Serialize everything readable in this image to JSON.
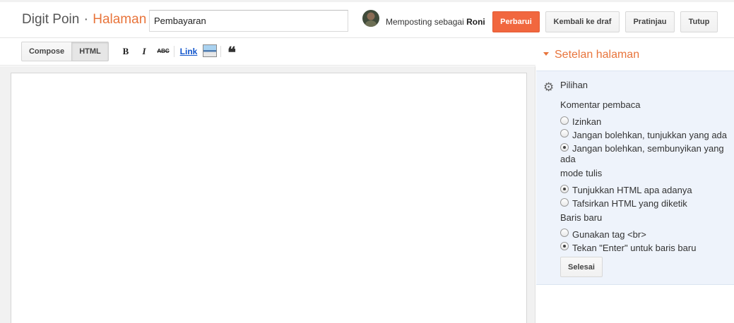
{
  "header": {
    "blog_name": "Digit Poin",
    "separator": "·",
    "section": "Halaman",
    "page_title_value": "Pembayaran",
    "posting_as_prefix": "Memposting sebagai",
    "user_name": "Roni",
    "buttons": {
      "update": "Perbarui",
      "back_to_draft": "Kembali ke draf",
      "preview": "Pratinjau",
      "close": "Tutup"
    }
  },
  "toolbar": {
    "compose": "Compose",
    "html": "HTML",
    "bold": "B",
    "italic": "I",
    "strike": "ABC",
    "link": "Link",
    "quote": "❝"
  },
  "sidebar": {
    "title": "Setelan halaman",
    "options_label": "Pilihan",
    "comments": {
      "heading": "Komentar pembaca",
      "options": [
        "Izinkan",
        "Jangan bolehkan, tunjukkan yang ada",
        "Jangan bolehkan, sembunyikan yang ada"
      ],
      "selected_index": 2
    },
    "compose_mode": {
      "heading": "mode tulis",
      "options": [
        "Tunjukkan HTML apa adanya",
        "Tafsirkan HTML yang diketik"
      ],
      "selected_index": 0
    },
    "line_breaks": {
      "heading": "Baris baru",
      "options": [
        "Gunakan tag <br>",
        "Tekan \"Enter\" untuk baris baru"
      ],
      "selected_index": 1
    },
    "done": "Selesai"
  },
  "icons": {
    "gear": "gear-icon",
    "caret": "caret-down-icon",
    "image": "image-icon",
    "quote": "quote-icon"
  },
  "colors": {
    "accent": "#e8743b",
    "primary_button": "#f1673f",
    "panel_background": "#eef3fb",
    "link": "#1155cc"
  }
}
